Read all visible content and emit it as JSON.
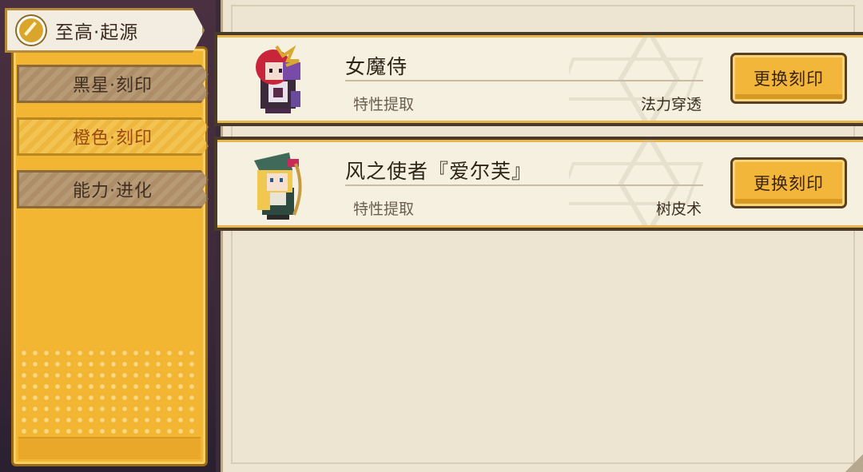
{
  "sidebar": {
    "top_tab": {
      "label": "至高·起源",
      "icon": "coin-icon"
    },
    "tabs": [
      {
        "label": "黑星·刻印",
        "active": false
      },
      {
        "label": "橙色·刻印",
        "active": true
      },
      {
        "label": "能力·进化",
        "active": false
      }
    ]
  },
  "cards": [
    {
      "name": "女魔侍",
      "property_label": "特性提取",
      "property_value": "法力穿透",
      "button_label": "更换刻印",
      "avatar": "red-haired-sorceress-avatar"
    },
    {
      "name": "风之使者『爱尔芙』",
      "property_label": "特性提取",
      "property_value": "树皮术",
      "button_label": "更换刻印",
      "avatar": "blonde-elf-archer-avatar"
    }
  ],
  "colors": {
    "accent": "#f2b632",
    "active_text": "#9a4a10",
    "panel": "#ede4d2"
  }
}
